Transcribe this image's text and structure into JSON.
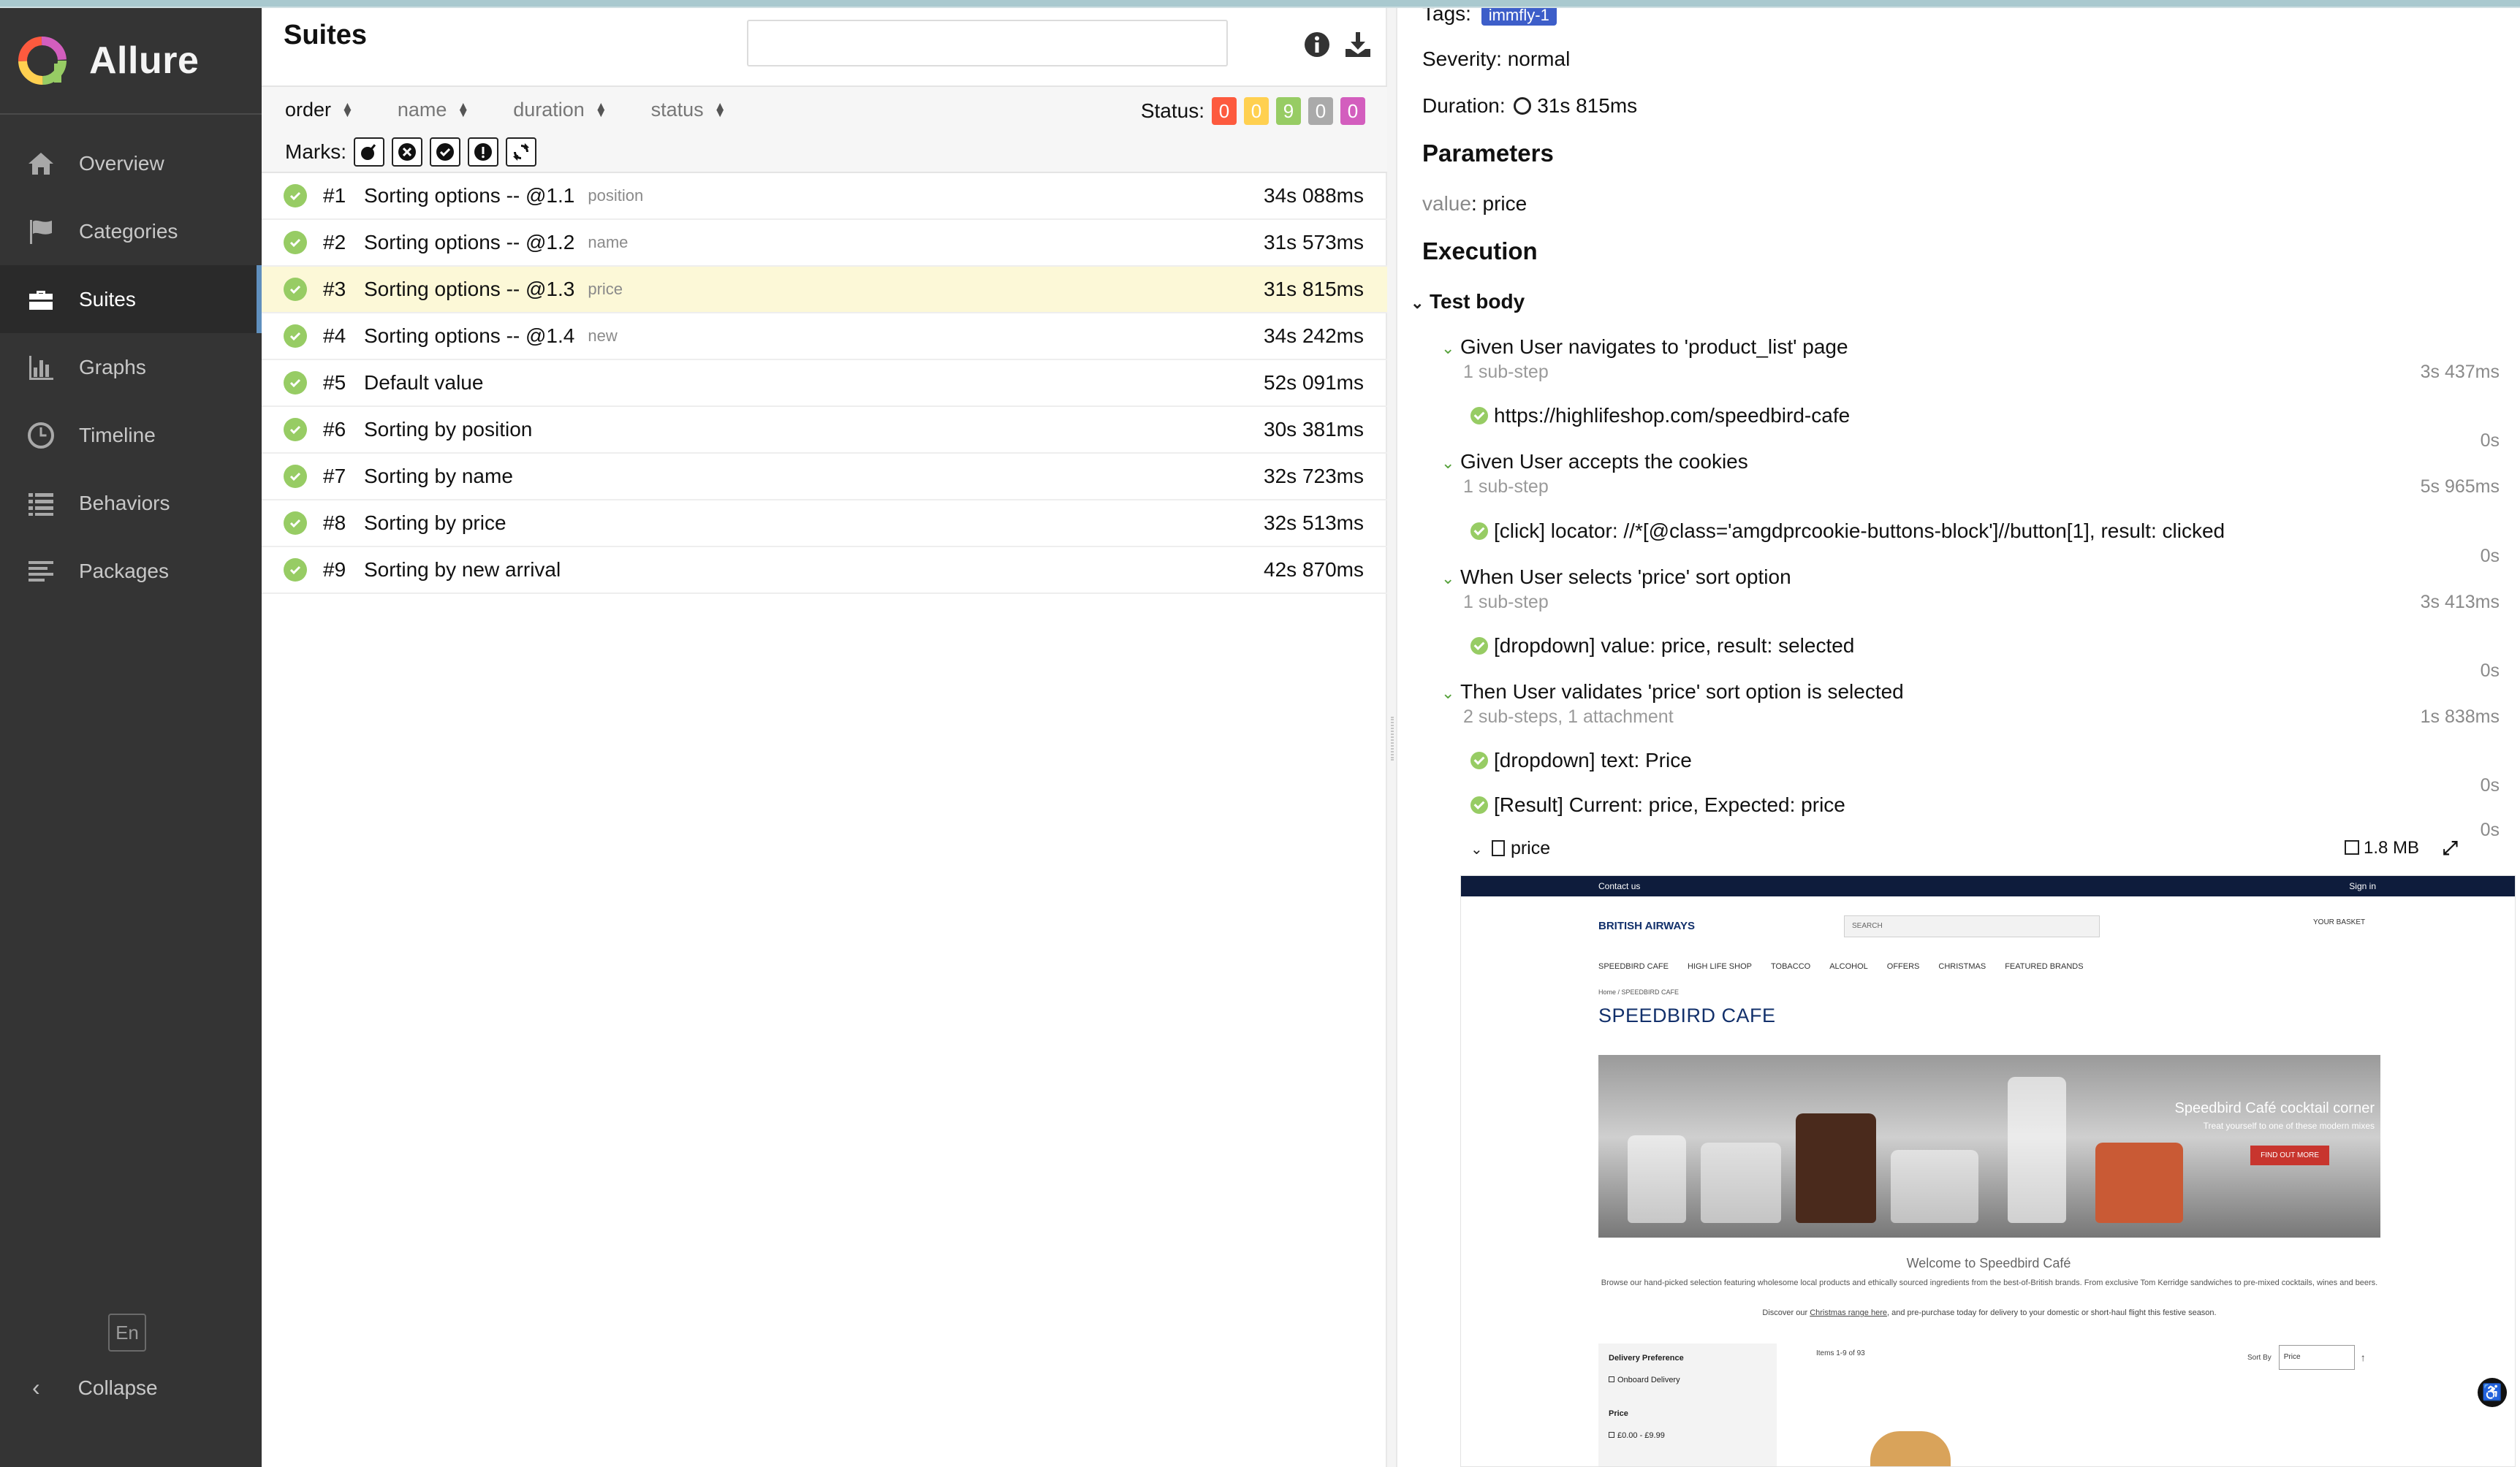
{
  "sidebar": {
    "brand": "Allure",
    "items": [
      {
        "label": "Overview",
        "icon": "home-icon"
      },
      {
        "label": "Categories",
        "icon": "flag-icon"
      },
      {
        "label": "Suites",
        "icon": "briefcase-icon",
        "active": true
      },
      {
        "label": "Graphs",
        "icon": "bar-chart-icon"
      },
      {
        "label": "Timeline",
        "icon": "clock-icon"
      },
      {
        "label": "Behaviors",
        "icon": "list-icon"
      },
      {
        "label": "Packages",
        "icon": "align-left-icon"
      }
    ],
    "language": "En",
    "collapse": "Collapse"
  },
  "suites": {
    "title": "Suites",
    "search": {
      "value": "",
      "placeholder": ""
    },
    "sort_columns": [
      "order",
      "name",
      "duration",
      "status"
    ],
    "status_label": "Status:",
    "status_counts": [
      {
        "value": "0",
        "color": "#fd5a3e"
      },
      {
        "value": "0",
        "color": "#ffd050"
      },
      {
        "value": "9",
        "color": "#97cc64"
      },
      {
        "value": "0",
        "color": "#aaaaaa"
      },
      {
        "value": "0",
        "color": "#d35ebe"
      }
    ],
    "marks_label": "Marks:",
    "rows": [
      {
        "num": "#1",
        "name": "Sorting options -- @1.1",
        "param": "position",
        "duration": "34s 088ms"
      },
      {
        "num": "#2",
        "name": "Sorting options -- @1.2",
        "param": "name",
        "duration": "31s 573ms"
      },
      {
        "num": "#3",
        "name": "Sorting options -- @1.3",
        "param": "price",
        "duration": "31s 815ms",
        "selected": true
      },
      {
        "num": "#4",
        "name": "Sorting options -- @1.4",
        "param": "new",
        "duration": "34s 242ms"
      },
      {
        "num": "#5",
        "name": "Default value",
        "param": "",
        "duration": "52s 091ms"
      },
      {
        "num": "#6",
        "name": "Sorting by position",
        "param": "",
        "duration": "30s 381ms"
      },
      {
        "num": "#7",
        "name": "Sorting by name",
        "param": "",
        "duration": "32s 723ms"
      },
      {
        "num": "#8",
        "name": "Sorting by price",
        "param": "",
        "duration": "32s 513ms"
      },
      {
        "num": "#9",
        "name": "Sorting by new arrival",
        "param": "",
        "duration": "42s 870ms"
      }
    ]
  },
  "details": {
    "tags_label": "Tags:",
    "tag": "immfly-1",
    "severity": "Severity: normal",
    "duration": "Duration:",
    "duration_value": "31s 815ms",
    "parameters_title": "Parameters",
    "param_key": "value",
    "param_value": ": price",
    "execution_title": "Execution",
    "test_body": "Test body",
    "steps": [
      {
        "title": "Given User navigates to 'product_list' page",
        "sub": "1 sub-step",
        "dur": "3s 437ms",
        "child": "https://highlifeshop.com/speedbird-cafe",
        "child_dur": "0s"
      },
      {
        "title": "Given User accepts the cookies",
        "sub": "1 sub-step",
        "dur": "5s 965ms",
        "child": "[click] locator: //*[@class='amgdprcookie-buttons-block']//button[1], result: clicked",
        "child_dur": "0s"
      },
      {
        "title": "When User selects 'price' sort option",
        "sub": "1 sub-step",
        "dur": "3s 413ms",
        "child": "[dropdown] value: price, result: selected",
        "child_dur": "0s"
      },
      {
        "title": "Then User validates 'price' sort option is selected",
        "sub": "2 sub-steps, 1 attachment",
        "dur": "1s 838ms",
        "child": "[dropdown] text: Price",
        "child_dur": "0s",
        "child2": "[Result] Current: price, Expected: price",
        "child2_dur": "0s"
      }
    ],
    "attachment": {
      "name": "price",
      "size": "1.8 MB"
    }
  },
  "preview": {
    "contact": "Contact us",
    "signin": "Sign in",
    "logo": "BRITISH AIRWAYS",
    "search": "SEARCH",
    "basket": "YOUR BASKET",
    "nav": [
      "SPEEDBIRD CAFE",
      "HIGH LIFE SHOP",
      "TOBACCO",
      "ALCOHOL",
      "OFFERS",
      "CHRISTMAS",
      "FEATURED BRANDS"
    ],
    "crumb": "Home / SPEEDBIRD CAFE",
    "title": "SPEEDBIRD CAFE",
    "banner_title": "Speedbird Café cocktail corner",
    "banner_sub": "Treat yourself to one of these modern mixes",
    "banner_btn": "FIND OUT MORE",
    "welcome": "Welcome to Speedbird Café",
    "desc": "Browse our hand-picked selection featuring wholesome local products and ethically sourced ingredients from the best-of-British brands. From exclusive Tom Kerridge sandwiches to pre-mixed cocktails, wines and beers.",
    "discover_a": "Discover our",
    "discover_link": "Christmas range here",
    "discover_b": ", and pre-purchase today for delivery to your domestic or short-haul flight this festive season.",
    "filter_title": "Delivery Preference",
    "filter_opt": "Onboard Delivery",
    "price_title": "Price",
    "price_opt": "£0.00 - £9.99",
    "items": "Items 1-9 of 93",
    "sort_by": "Sort By",
    "sort_value": "Price"
  }
}
